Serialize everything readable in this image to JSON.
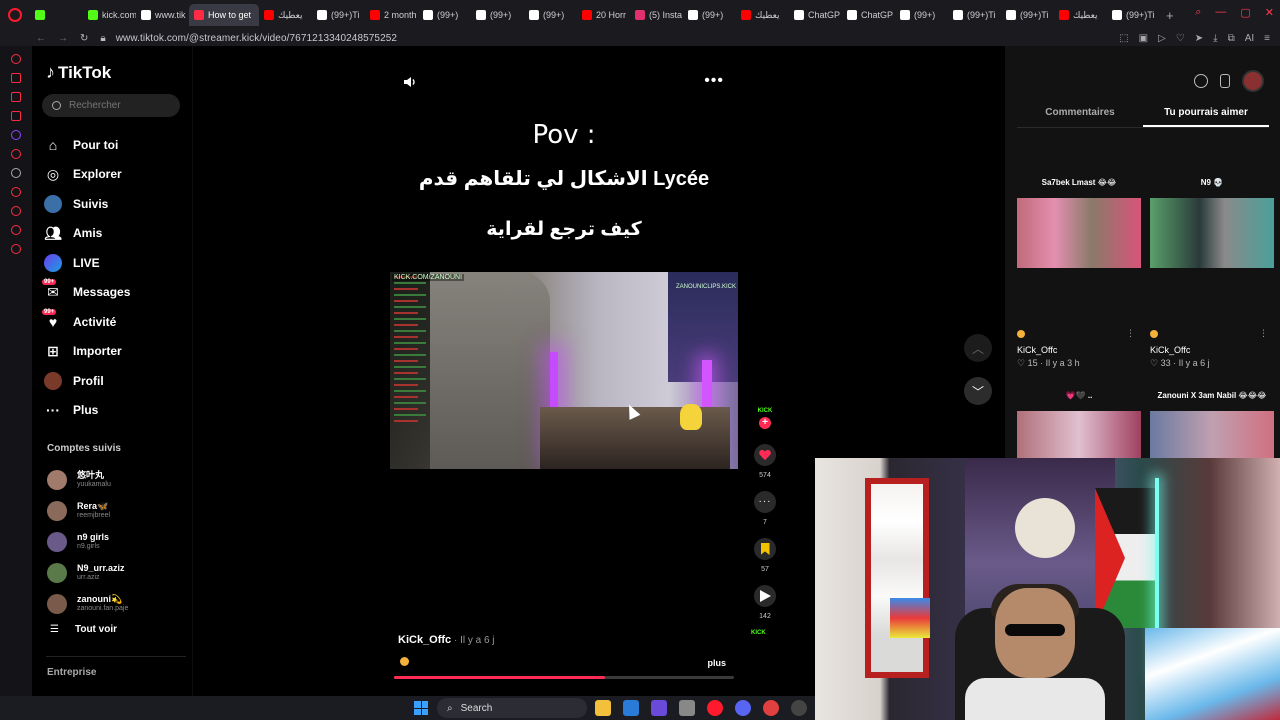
{
  "browser": {
    "tabs": [
      {
        "label": "",
        "color": "#53fc18"
      },
      {
        "label": "kick.com",
        "color": "#53fc18"
      },
      {
        "label": "www.tik",
        "color": "#ffffff"
      },
      {
        "label": "How to get",
        "color": "#ff2b42",
        "active": true
      },
      {
        "label": "يعطيك",
        "color": "#ff0000"
      },
      {
        "label": "(99+)Ti",
        "color": "#ffffff"
      },
      {
        "label": "2 month",
        "color": "#ff0000"
      },
      {
        "label": "(99+)",
        "color": "#ffffff"
      },
      {
        "label": "(99+)",
        "color": "#ffffff"
      },
      {
        "label": "(99+)",
        "color": "#ffffff"
      },
      {
        "label": "20 Horr",
        "color": "#ff0000"
      },
      {
        "label": "(5) Insta",
        "color": "#e1306c"
      },
      {
        "label": "(99+)",
        "color": "#ffffff"
      },
      {
        "label": "يعطيك",
        "color": "#ff0000"
      },
      {
        "label": "ChatGP",
        "color": "#ffffff"
      },
      {
        "label": "ChatGP",
        "color": "#ffffff"
      },
      {
        "label": "(99+)",
        "color": "#ffffff"
      },
      {
        "label": "(99+)Ti",
        "color": "#ffffff"
      },
      {
        "label": "(99+)Ti",
        "color": "#ffffff"
      },
      {
        "label": "يعطيك",
        "color": "#ff0000"
      },
      {
        "label": "(99+)Ti",
        "color": "#ffffff"
      }
    ],
    "url": "www.tiktok.com/@streamer.kick/video/7671213340248575252",
    "new_tab": "+",
    "ai_label": "AI"
  },
  "nav": {
    "logo": "TikTok",
    "search_placeholder": "Rechercher",
    "items": [
      {
        "label": "Pour toi",
        "icon": "home-icon"
      },
      {
        "label": "Explorer",
        "icon": "compass-icon"
      },
      {
        "label": "Suivis",
        "icon": "following-avatar-icon"
      },
      {
        "label": "Amis",
        "icon": "friends-icon"
      },
      {
        "label": "LIVE",
        "icon": "live-icon"
      },
      {
        "label": "Messages",
        "icon": "messages-icon",
        "badge": "99+"
      },
      {
        "label": "Activité",
        "icon": "activity-icon",
        "badge": "99+"
      },
      {
        "label": "Importer",
        "icon": "upload-icon"
      },
      {
        "label": "Profil",
        "icon": "profile-avatar-icon"
      },
      {
        "label": "Plus",
        "icon": "more-dots-icon"
      }
    ],
    "following_title": "Comptes suivis",
    "following": [
      {
        "name": "悠叶丸",
        "handle": "yuukamalu",
        "color": "#a07a6a"
      },
      {
        "name": "Rera🦋",
        "handle": "reemjbreel",
        "color": "#8a6a5a"
      },
      {
        "name": "n9 girls",
        "handle": "n9.girls",
        "color": "#6a5a8a"
      },
      {
        "name": "N9_urr.aziz",
        "handle": "urr.aziz",
        "color": "#5a7a4a"
      },
      {
        "name": "zanouni💫",
        "handle": "zanouni.fan.paje",
        "color": "#7a5a4a"
      }
    ],
    "see_all": "Tout voir",
    "enterprise": "Entreprise"
  },
  "video": {
    "line1": "Pov :",
    "line2": "الاشكال لي تلقاهم قدم Lycée",
    "line3": "كيف ترجع لقراية",
    "watermark_left": "KICK.COM/ZANOUNI",
    "watermark_right": "ZANOUNICLIPS.KICK",
    "author": "KiCk_Offc",
    "time": " · Il y a 6 j",
    "more": "plus",
    "progress_percent": 62
  },
  "actions": {
    "avatar_text": "KICK",
    "likes": "574",
    "comments": "7",
    "saves": "57",
    "shares": "142",
    "disc_text": "KICK"
  },
  "right": {
    "tabs": [
      "Commentaires",
      "Tu pourrais aimer"
    ],
    "active_tab": 1,
    "cards": [
      {
        "caption": "Sa7bek Lmast 😂😂",
        "name": "KiCk_Offc",
        "stats": "♡ 15 · Il y a 3 h",
        "thumb": "t1"
      },
      {
        "caption": "N9 💀",
        "name": "KiCk_Offc",
        "stats": "♡ 33 · Il y a 6 j",
        "thumb": "t2"
      },
      {
        "caption": "💗🖤 ..",
        "name": "",
        "stats": "",
        "thumb": "t3"
      },
      {
        "caption": "Zanouni X 3am Nabil 😂😂😂",
        "name": "",
        "stats": "",
        "thumb": "t4"
      }
    ]
  },
  "taskbar": {
    "search_label": "Search"
  }
}
